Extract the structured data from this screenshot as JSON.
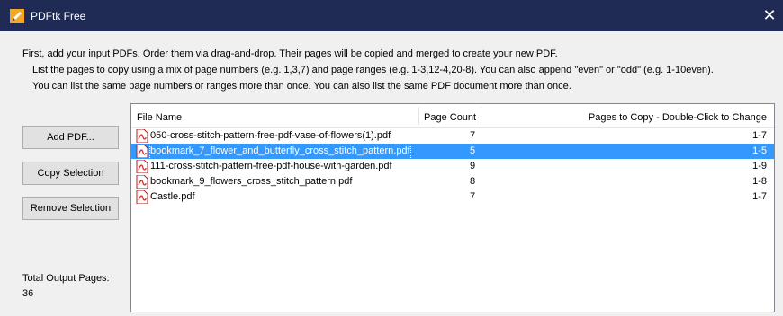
{
  "window": {
    "title": "PDFtk Free",
    "close_glyph": "✕",
    "icon": "pdftk-pencil-icon"
  },
  "instructions": {
    "line1": "First, add your input PDFs. Order them via drag-and-drop. Their pages will be copied and merged to create your new PDF.",
    "line2": "List the pages to copy using a mix of page numbers (e.g. 1,3,7) and page ranges (e.g. 1-3,12-4,20-8). You can also append \"even\" or \"odd\" (e.g. 1-10even).",
    "line3": "You can list the same page numbers or ranges more than once. You can also list the same PDF document more than once."
  },
  "buttons": {
    "add_pdf": "Add PDF...",
    "copy_selection": "Copy Selection",
    "remove_selection": "Remove Selection"
  },
  "total": {
    "label": "Total Output Pages:",
    "value": "36"
  },
  "table": {
    "headers": {
      "file_name": "File Name",
      "page_count": "Page Count",
      "pages_to_copy": "Pages to Copy - Double-Click to Change"
    },
    "rows": [
      {
        "file": "050-cross-stitch-pattern-free-pdf-vase-of-flowers(1).pdf",
        "count": "7",
        "pages": "1-7",
        "selected": false
      },
      {
        "file": "bookmark_7_flower_and_butterfly_cross_stitch_pattern.pdf",
        "count": "5",
        "pages": "1-5",
        "selected": true
      },
      {
        "file": "111-cross-stitch-pattern-free-pdf-house-with-garden.pdf",
        "count": "9",
        "pages": "1-9",
        "selected": false
      },
      {
        "file": "bookmark_9_flowers_cross_stitch_pattern.pdf",
        "count": "8",
        "pages": "1-8",
        "selected": false
      },
      {
        "file": "Castle.pdf",
        "count": "7",
        "pages": "1-7",
        "selected": false
      }
    ]
  },
  "colors": {
    "titlebar": "#1f2a55",
    "selection": "#3399ff",
    "pdf_icon": "#d32f2f"
  }
}
